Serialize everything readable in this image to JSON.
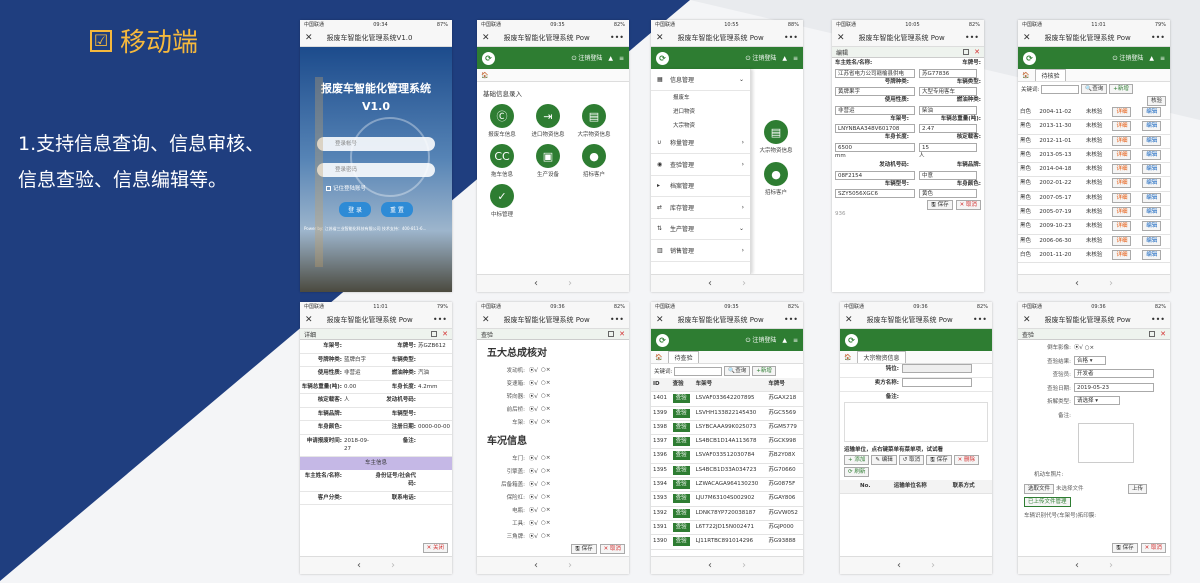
{
  "heading": {
    "checkbox": "☑",
    "title": "移动端"
  },
  "desc": {
    "line1": "1.支持信息查询、信息审核、",
    "line2": "信息查验、信息编辑等。"
  },
  "common": {
    "x": "✕",
    "dots": "•••",
    "back": "‹",
    "fwd": "›",
    "logout": "注销登陆",
    "save": "保存",
    "cancel": "取消",
    "close": "关闭",
    "query": "查询",
    "add": "新增",
    "edit": "编辑",
    "verify": "核验",
    "inspect": "查验",
    "home": "🏠",
    "search_label": "关键词:"
  },
  "screens": [
    {
      "carrier": "中国联通",
      "time": "09:34",
      "batt": "87%",
      "title": "报废车智能化管理系统V1.0",
      "sys_title1": "报废车智能化管理系统",
      "sys_title2": "V1.0",
      "account_ph": "登录帐号",
      "password_ph": "登录密码",
      "remember": "记住登陆账号",
      "login": "登 录",
      "reset": "重 置",
      "powered": "Power by: 江苏省三业智能化科技有限公司 技术支持：400-811-6..."
    },
    {
      "carrier": "中国联通",
      "time": "09:35",
      "batt": "82%",
      "title": "报废车智能化管理系统 Pow",
      "section": "基础信息录入",
      "icons": [
        {
          "sym": "Ⓒ",
          "label": "报废车信息"
        },
        {
          "sym": "⇥",
          "label": "进口物资信息"
        },
        {
          "sym": "▤",
          "label": "大宗物资信息"
        },
        {
          "sym": "CC",
          "label": "拖车信息"
        },
        {
          "sym": "▣",
          "label": "生产设备"
        },
        {
          "sym": "●",
          "label": "招标客户"
        },
        {
          "sym": "✓",
          "label": "中标管理"
        }
      ]
    },
    {
      "carrier": "中国联通",
      "time": "10:55",
      "batt": "88%",
      "title": "报废车智能化管理系统 Pow",
      "menu": [
        {
          "sym": "▦",
          "label": "信息管理",
          "arrow": "⌄"
        },
        {
          "sym": "∪",
          "label": "称量管理",
          "arrow": "›"
        },
        {
          "sym": "◉",
          "label": "查验管理",
          "arrow": "›"
        },
        {
          "sym": "▸",
          "label": "档案管理",
          "arrow": ""
        },
        {
          "sym": "⇄",
          "label": "库存管理",
          "arrow": "›"
        },
        {
          "sym": "⇅",
          "label": "生产管理",
          "arrow": "⌄"
        },
        {
          "sym": "▥",
          "label": "销售管理",
          "arrow": "›"
        }
      ],
      "submenu": [
        "报废车",
        "进口物资",
        "大宗物资"
      ],
      "side_icon1": "大宗物资信息",
      "side_icon2": "招标客户"
    },
    {
      "carrier": "中国联通",
      "time": "10:05",
      "batt": "82%",
      "title": "报废车智能化管理系统 Pow",
      "panel": "编辑",
      "rows": [
        [
          "车主姓名/名称:",
          "车牌号:"
        ],
        [
          "江苏省电力公司赣榆县供电",
          "苏G77836"
        ],
        [
          "号牌种类:",
          "车辆类型:"
        ],
        [
          "黄牌果字",
          "大型专用客车"
        ],
        [
          "使用性质:",
          "燃油种类:"
        ],
        [
          "非营运",
          "柴油"
        ],
        [
          "车架号:",
          "车辆总重量(吨):"
        ],
        [
          "LNYNBAA348V601708",
          "2.47"
        ],
        [
          "车身长度:",
          "核定载客:"
        ],
        [
          "6500",
          "15"
        ],
        [
          "mm",
          "人"
        ],
        [
          "发动机号码:",
          "车辆品牌:"
        ],
        [
          "08F2154",
          "中意"
        ],
        [
          "车辆型号:",
          "车身颜色:"
        ],
        [
          "SZY5056XGC6",
          "黄色"
        ]
      ],
      "bottom": "936"
    },
    {
      "carrier": "中国联通",
      "time": "11:01",
      "batt": "79%",
      "title": "报废车智能化管理系统 Pow",
      "tab": "待核验",
      "rows": [
        [
          "白色",
          "2004-11-02",
          "未核验"
        ],
        [
          "黑色",
          "2013-11-30",
          "未核验"
        ],
        [
          "黑色",
          "2012-11-01",
          "未核验"
        ],
        [
          "黑色",
          "2013-05-13",
          "未核验"
        ],
        [
          "黑色",
          "2014-04-18",
          "未核验"
        ],
        [
          "黑色",
          "2002-01-22",
          "未核验"
        ],
        [
          "黑色",
          "2007-05-17",
          "未核验"
        ],
        [
          "黑色",
          "2005-07-19",
          "未核验"
        ],
        [
          "黑色",
          "2009-10-23",
          "未核验"
        ],
        [
          "黑色",
          "2006-06-30",
          "未核验"
        ],
        [
          "白色",
          "2001-11-20",
          "未核验"
        ]
      ],
      "col_detail": "详细",
      "col_edit": "编辑"
    },
    {
      "carrier": "中国联通",
      "time": "11:01",
      "batt": "79%",
      "title": "报废车智能化管理系统 Pow",
      "panel": "详细",
      "fields": [
        [
          "车架号:",
          "",
          "车牌号:",
          "苏GZB612"
        ],
        [
          "号牌种类:",
          "蓝牌白字",
          "车辆类型:",
          ""
        ],
        [
          "使用性质:",
          "非营运",
          "燃油种类:",
          "汽油"
        ],
        [
          "车辆总重量(吨):",
          "0.00",
          "车身长度:",
          "4.2mm"
        ],
        [
          "核定载客:",
          "人",
          "发动机号码:",
          ""
        ],
        [
          "车辆品牌:",
          "",
          "车辆型号:",
          ""
        ],
        [
          "车身颜色:",
          "",
          "注册日期:",
          "0000-00-00"
        ],
        [
          "申请报废时间:",
          "2018-09-27",
          "备注:",
          ""
        ]
      ],
      "owner_section": "车主信息",
      "owner_fields": [
        [
          "车主姓名/名称:",
          "",
          "身份证号/社会代码:",
          ""
        ],
        [
          "客户分类:",
          "",
          "联系电话:",
          ""
        ]
      ]
    },
    {
      "carrier": "中国联通",
      "time": "09:36",
      "batt": "82%",
      "title": "报废车智能化管理系统 Pow",
      "panel": "查验",
      "sec1": "五大总成核对",
      "parts1": [
        "发动机:",
        "变速箱:",
        "转向器:",
        "前后桥:",
        "车架:"
      ],
      "sec2": "车况信息",
      "parts2": [
        "车门:",
        "引擎盖:",
        "后备箱盖:",
        "保险杠:",
        "电瓶:",
        "工具:",
        "三角牌:"
      ]
    },
    {
      "carrier": "中国联通",
      "time": "09:35",
      "batt": "82%",
      "title": "报废车智能化管理系统 Pow",
      "tab": "待查验",
      "head": [
        "ID",
        "查验",
        "车架号",
        "车牌号"
      ],
      "rows": [
        [
          "1401",
          "LSVAF033642207895",
          "苏GAX218"
        ],
        [
          "1399",
          "LSVHH133822145430",
          "苏GC5569"
        ],
        [
          "1398",
          "LSYBCAAA99K025073",
          "苏GM5779"
        ],
        [
          "1397",
          "LS4BCB1D14A113678",
          "苏GCK998"
        ],
        [
          "1396",
          "LSVAF033512030784",
          "苏B2Y08X"
        ],
        [
          "1395",
          "LS4BCB1D33A034723",
          "苏G70660"
        ],
        [
          "1394",
          "LZWACAGA964130230",
          "苏G0875F"
        ],
        [
          "1393",
          "LJU7M63104S002902",
          "苏GAY806"
        ],
        [
          "1392",
          "LDNK78YP720038187",
          "苏GVW052"
        ],
        [
          "1391",
          "L6T722JD15N002471",
          "苏GJP000"
        ],
        [
          "1390",
          "LJ11RTBC891014296",
          "苏G93888"
        ]
      ]
    },
    {
      "carrier": "中国联通",
      "time": "09:36",
      "batt": "82%",
      "title": "报废车智能化管理系统 Pow",
      "tab": "大宗物资信息",
      "f1": "钝位:",
      "f2": "卖方名称:",
      "f3": "备注:",
      "hint": "运输单位，点右键菜单有菜单项，试试看",
      "b_add": "添加",
      "b_edit": "编辑",
      "b_cancel": "取消",
      "b_save": "保存",
      "b_del": "删除",
      "b_refresh": "刷新",
      "cols": [
        "No.",
        "运输单位名称",
        "联系方式"
      ]
    },
    {
      "carrier": "中国联通",
      "time": "09:36",
      "batt": "82%",
      "title": "报废车智能化管理系统 Pow",
      "panel": "查验",
      "f_photo": "倒车影像:",
      "f_result": "查验结果:",
      "v_result": "合格",
      "f_person": "查验员:",
      "v_person": "开发者",
      "f_date": "查验日期:",
      "v_date": "2019-05-23",
      "f_dis": "拆解类型:",
      "v_dis": "请选择",
      "f_note": "备注:",
      "f_motor": "机动车照片:",
      "choose": "选取文件",
      "nofile": "未选择文件",
      "upload": "上传",
      "uploaded": "已上传文件管理",
      "f_vin": "车辆识别代号(车架号)拓印膜:"
    }
  ]
}
